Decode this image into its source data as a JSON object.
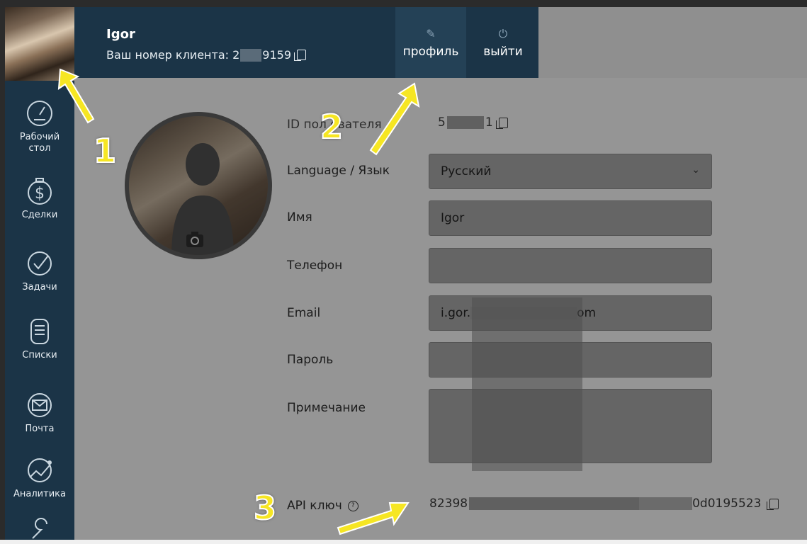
{
  "header": {
    "user_name": "Igor",
    "client_label": "Ваш номер клиента: 2",
    "client_suffix": "9159",
    "profile_label": "профиль",
    "logout_label": "выйти",
    "profile_icon": "pencil-icon",
    "logout_icon": "power-icon"
  },
  "sidebar": {
    "items": [
      {
        "label": "Рабочий стол",
        "icon": "speedometer-icon"
      },
      {
        "label": "Сделки",
        "icon": "dollar-icon"
      },
      {
        "label": "Задачи",
        "icon": "checkmark-icon"
      },
      {
        "label": "Списки",
        "icon": "list-icon"
      },
      {
        "label": "Почта",
        "icon": "mail-icon"
      },
      {
        "label": "Аналитика",
        "icon": "analytics-icon"
      }
    ]
  },
  "form": {
    "user_id_label": "ID пол   ователя",
    "user_id_value_prefix": "5",
    "user_id_value_suffix": "1",
    "language_label": "Language / Язык",
    "language_value": "Русский",
    "name_label": "Имя",
    "name_value": "Igor",
    "phone_label": "Телефон",
    "phone_value": "",
    "email_label": "Email",
    "email_value_prefix": "i.gor.",
    "email_value_suffix": "om",
    "password_label": "Пароль",
    "password_value": "",
    "note_label": "Примечание",
    "note_value": "",
    "api_label": "API ключ",
    "api_value_prefix": "82398",
    "api_value_suffix": "0d0195523"
  },
  "annotations": {
    "marker_1": "1",
    "marker_2": "2",
    "marker_3": "3",
    "arrow_color": "#f6e623"
  },
  "colors": {
    "sidebar": "#1b3447",
    "profile_active": "#244156",
    "overlay": "rgba(0,0,0,0.38)"
  }
}
